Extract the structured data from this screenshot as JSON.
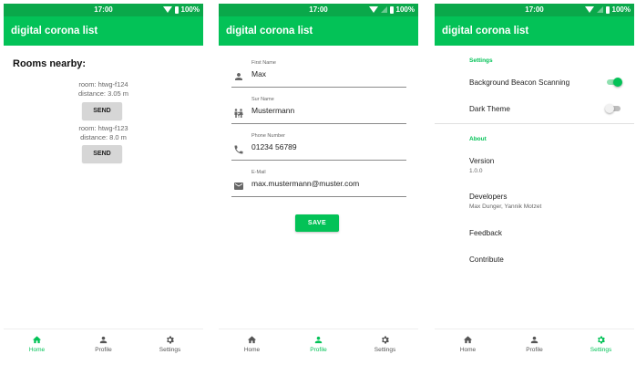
{
  "status_bar": {
    "time": "17:00",
    "battery": "100%"
  },
  "app_title": "digital corona list",
  "nav": {
    "home": "Home",
    "profile": "Profile",
    "settings": "Settings"
  },
  "home": {
    "heading": "Rooms nearby:",
    "rooms": [
      {
        "room": "room: htwg-f124",
        "distance": "distance: 3.05 m",
        "button": "SEND"
      },
      {
        "room": "room: htwg-f123",
        "distance": "distance: 8.0 m",
        "button": "SEND"
      }
    ]
  },
  "profile": {
    "fields": [
      {
        "label": "First Name",
        "value": "Max",
        "icon": "person-icon"
      },
      {
        "label": "Sur Name",
        "value": "Mustermann",
        "icon": "family-icon"
      },
      {
        "label": "Phone Number",
        "value": "01234 56789",
        "icon": "phone-icon"
      },
      {
        "label": "E-Mail",
        "value": "max.mustermann@muster.com",
        "icon": "email-icon"
      }
    ],
    "save_label": "SAVE"
  },
  "settings": {
    "section_settings": "Settings",
    "background_scanning": {
      "label": "Background Beacon Scanning",
      "enabled": true
    },
    "dark_theme": {
      "label": "Dark Theme",
      "enabled": false
    },
    "section_about": "About",
    "version": {
      "label": "Version",
      "value": "1.0.0"
    },
    "developers": {
      "label": "Developers",
      "value": "Max Dunger, Yannik Motzet"
    },
    "feedback": "Feedback",
    "contribute": "Contribute"
  },
  "colors": {
    "primary": "#03c257",
    "status_bar": "#0aa84a",
    "button_grey": "#d6d6d6"
  }
}
